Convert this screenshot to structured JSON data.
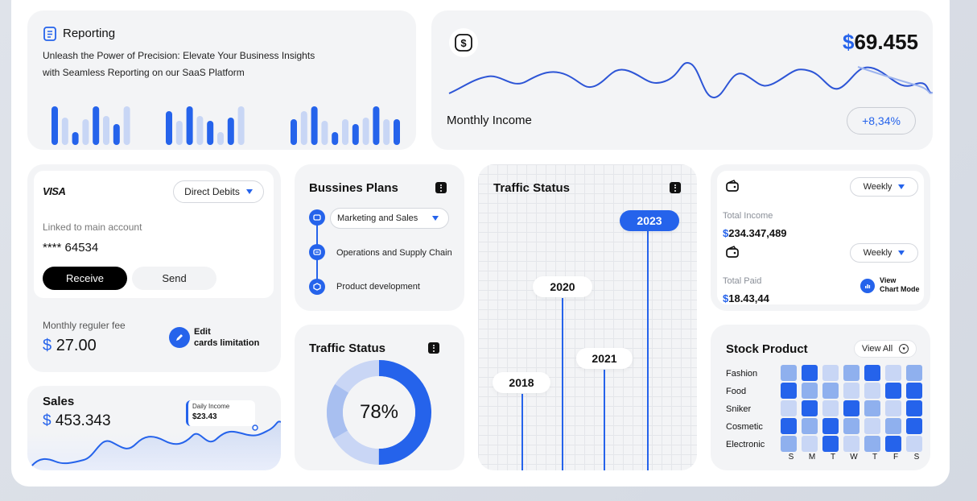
{
  "colors": {
    "primary": "#2563eb",
    "mid": "#8fb0ee",
    "light": "#c8d6f5",
    "background": "#f3f4f6"
  },
  "reporting": {
    "title": "Reporting",
    "line1": "Unleash the Power of Precision: Elevate Your Business Insights",
    "line2": "with Seamless Reporting on our SaaS Platform",
    "icon": "document-icon"
  },
  "income": {
    "icon": "dollar-icon",
    "currency": "$",
    "amount": "69.455",
    "label": "Monthly Income",
    "change": "+8,34%"
  },
  "card": {
    "brand": "VISA",
    "dropdown": "Direct Debits",
    "linked_label": "Linked to main account",
    "number": "**** 64534",
    "receive": "Receive",
    "send": "Send",
    "fee_label": "Monthly reguler fee",
    "fee_currency": "$",
    "fee_amount": "27.00",
    "edit_line1": "Edit",
    "edit_line2": "cards limitation"
  },
  "plans": {
    "title": "Bussines Plans",
    "items": [
      {
        "label": "Marketing and Sales"
      },
      {
        "label": "Operations and Supply Chain"
      },
      {
        "label": "Product development"
      }
    ]
  },
  "traffic_donut": {
    "title": "Traffic Status",
    "value": "78%"
  },
  "traffic_years": {
    "title": "Traffic Status",
    "years": [
      "2023",
      "2020",
      "2021",
      "2018"
    ]
  },
  "totals": {
    "filter1": "Weekly",
    "filter2": "Weekly",
    "income_label": "Total Income",
    "income_currency": "$",
    "income_value": "234.347,489",
    "paid_label": "Total Paid",
    "paid_currency": "$",
    "paid_value": "18.43,44",
    "view_line1": "View",
    "view_line2": "Chart Mode"
  },
  "sales": {
    "title": "Sales",
    "currency": "$",
    "amount": "453.343",
    "tooltip_label": "Daily Income",
    "tooltip_value": "$23.43"
  },
  "stock": {
    "title": "Stock Product",
    "view_all": "View All",
    "rows": [
      "Fashion",
      "Food",
      "Sniker",
      "Cosmetic",
      "Electronic"
    ],
    "days": [
      "S",
      "M",
      "T",
      "W",
      "T",
      "F",
      "S"
    ]
  }
}
